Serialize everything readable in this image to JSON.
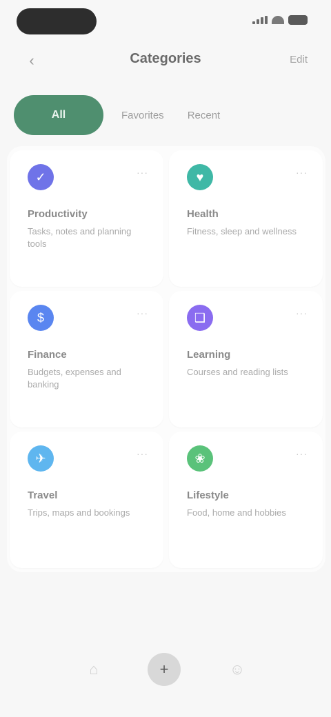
{
  "status": {
    "time": "",
    "icons": [
      "signal-icon",
      "wifi-icon",
      "battery-icon"
    ]
  },
  "header": {
    "title": "Categories",
    "back_icon": "chevron-left-icon",
    "action_label": "Edit"
  },
  "tabs": [
    {
      "label": "All",
      "active": true
    },
    {
      "label": "Favorites",
      "active": false
    },
    {
      "label": "Recent",
      "active": false
    }
  ],
  "cards": [
    {
      "title": "Productivity",
      "desc": "Tasks, notes and planning tools",
      "icon": "checklist-icon",
      "color": "#6f73e8"
    },
    {
      "title": "Health",
      "desc": "Fitness, sleep and wellness",
      "icon": "heart-icon",
      "color": "#3fb8a6"
    },
    {
      "title": "Finance",
      "desc": "Budgets, expenses and banking",
      "icon": "wallet-icon",
      "color": "#5a86f0"
    },
    {
      "title": "Learning",
      "desc": "Courses and reading lists",
      "icon": "book-icon",
      "color": "#8a6cf0"
    },
    {
      "title": "Travel",
      "desc": "Trips, maps and bookings",
      "icon": "plane-icon",
      "color": "#5fb6ef"
    },
    {
      "title": "Lifestyle",
      "desc": "Food, home and hobbies",
      "icon": "leaf-icon",
      "color": "#5ac27a"
    }
  ],
  "bottom_nav": [
    {
      "name": "home",
      "icon": "home-icon"
    },
    {
      "name": "add",
      "icon": "plus-icon"
    },
    {
      "name": "profile",
      "icon": "user-icon"
    }
  ]
}
